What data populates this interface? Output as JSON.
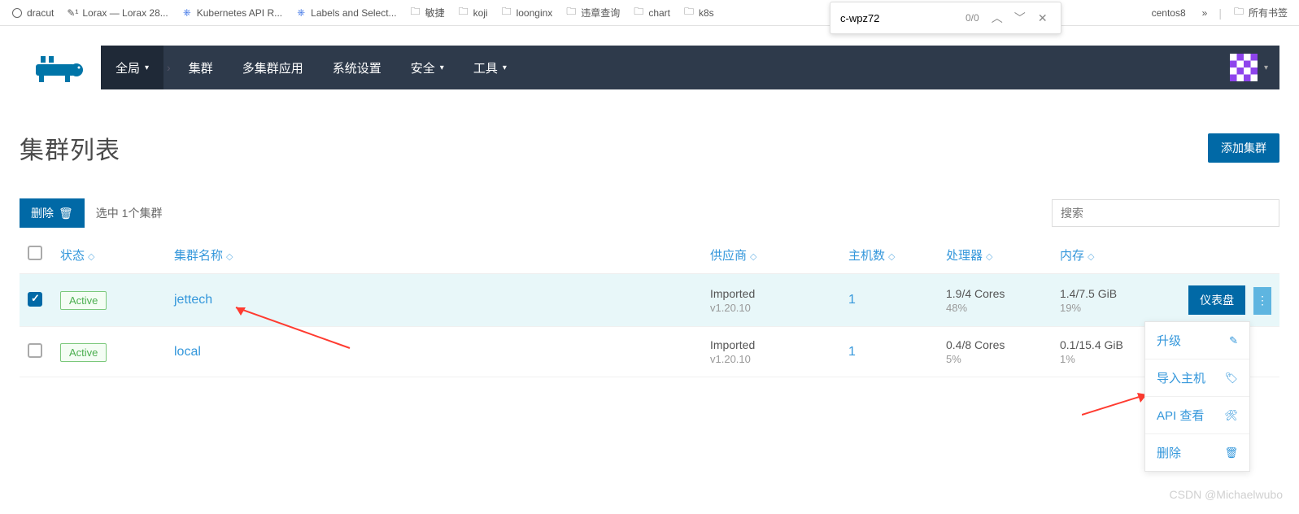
{
  "bookmarks": {
    "items": [
      {
        "label": "dracut",
        "icon": "globe"
      },
      {
        "label": "Lorax — Lorax 28...",
        "icon": "pen"
      },
      {
        "label": "Kubernetes API R...",
        "icon": "k8s"
      },
      {
        "label": "Labels and Select...",
        "icon": "k8s"
      },
      {
        "label": "敏捷",
        "icon": "folder"
      },
      {
        "label": "koji",
        "icon": "folder"
      },
      {
        "label": "loonginx",
        "icon": "folder"
      },
      {
        "label": "违章查询",
        "icon": "folder"
      },
      {
        "label": "chart",
        "icon": "folder"
      },
      {
        "label": "k8s",
        "icon": "folder"
      }
    ],
    "overflow_label": "centos8",
    "more_glyph": "»",
    "all_label": "所有书签"
  },
  "find": {
    "query": "c-wpz72",
    "count": "0/0"
  },
  "nav": {
    "global": "全局",
    "cluster": "集群",
    "multi": "多集群应用",
    "settings": "系统设置",
    "security": "安全",
    "tools": "工具"
  },
  "page": {
    "title": "集群列表",
    "add_button": "添加集群",
    "delete_button": "删除",
    "selection_text": "选中 1个集群",
    "search_placeholder": "搜索"
  },
  "columns": {
    "state": "状态",
    "name": "集群名称",
    "provider": "供应商",
    "nodes": "主机数",
    "cpu": "处理器",
    "ram": "内存"
  },
  "rows": [
    {
      "checked": true,
      "state": "Active",
      "name": "jettech",
      "provider": "Imported",
      "version": "v1.20.10",
      "nodes": "1",
      "cpu": "1.9/4 Cores",
      "cpu_pct": "48%",
      "ram": "1.4/7.5 GiB",
      "ram_pct": "19%",
      "dashboard": "仪表盘"
    },
    {
      "checked": false,
      "state": "Active",
      "name": "local",
      "provider": "Imported",
      "version": "v1.20.10",
      "nodes": "1",
      "cpu": "0.4/8 Cores",
      "cpu_pct": "5%",
      "ram": "0.1/15.4 GiB",
      "ram_pct": "1%"
    }
  ],
  "dropdown": {
    "upgrade": "升级",
    "import_host": "导入主机",
    "api_view": "API 查看",
    "delete": "删除"
  },
  "watermark": "CSDN @Michaelwubo"
}
